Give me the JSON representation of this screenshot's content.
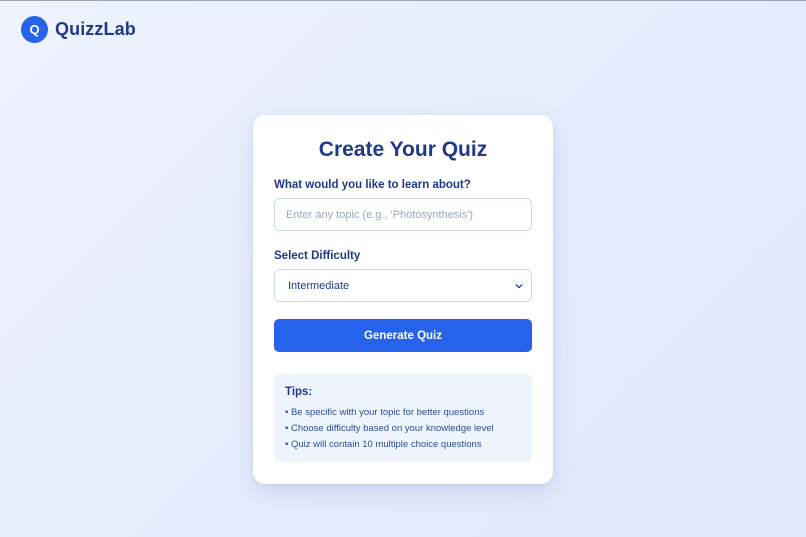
{
  "brand": {
    "logo_letter": "Q",
    "name": "QuizzLab"
  },
  "card": {
    "title": "Create Your Quiz",
    "topic": {
      "label": "What would you like to learn about?",
      "value": "",
      "placeholder": "Enter any topic (e.g., 'Photosynthesis')"
    },
    "difficulty": {
      "label": "Select Difficulty",
      "selected": "Intermediate"
    },
    "generate_label": "Generate Quiz",
    "tips": {
      "title": "Tips:",
      "items": [
        "• Be specific with your topic for better questions",
        "• Choose difficulty based on your knowledge level",
        "• Quiz will contain 10 multiple choice questions"
      ]
    }
  },
  "colors": {
    "accent": "#2563eb",
    "heading": "#1e3a8a",
    "tips_background": "#eff5ff",
    "input_border": "#bfe0ea"
  },
  "icons": {
    "select_arrow": "chevron-down-icon"
  }
}
